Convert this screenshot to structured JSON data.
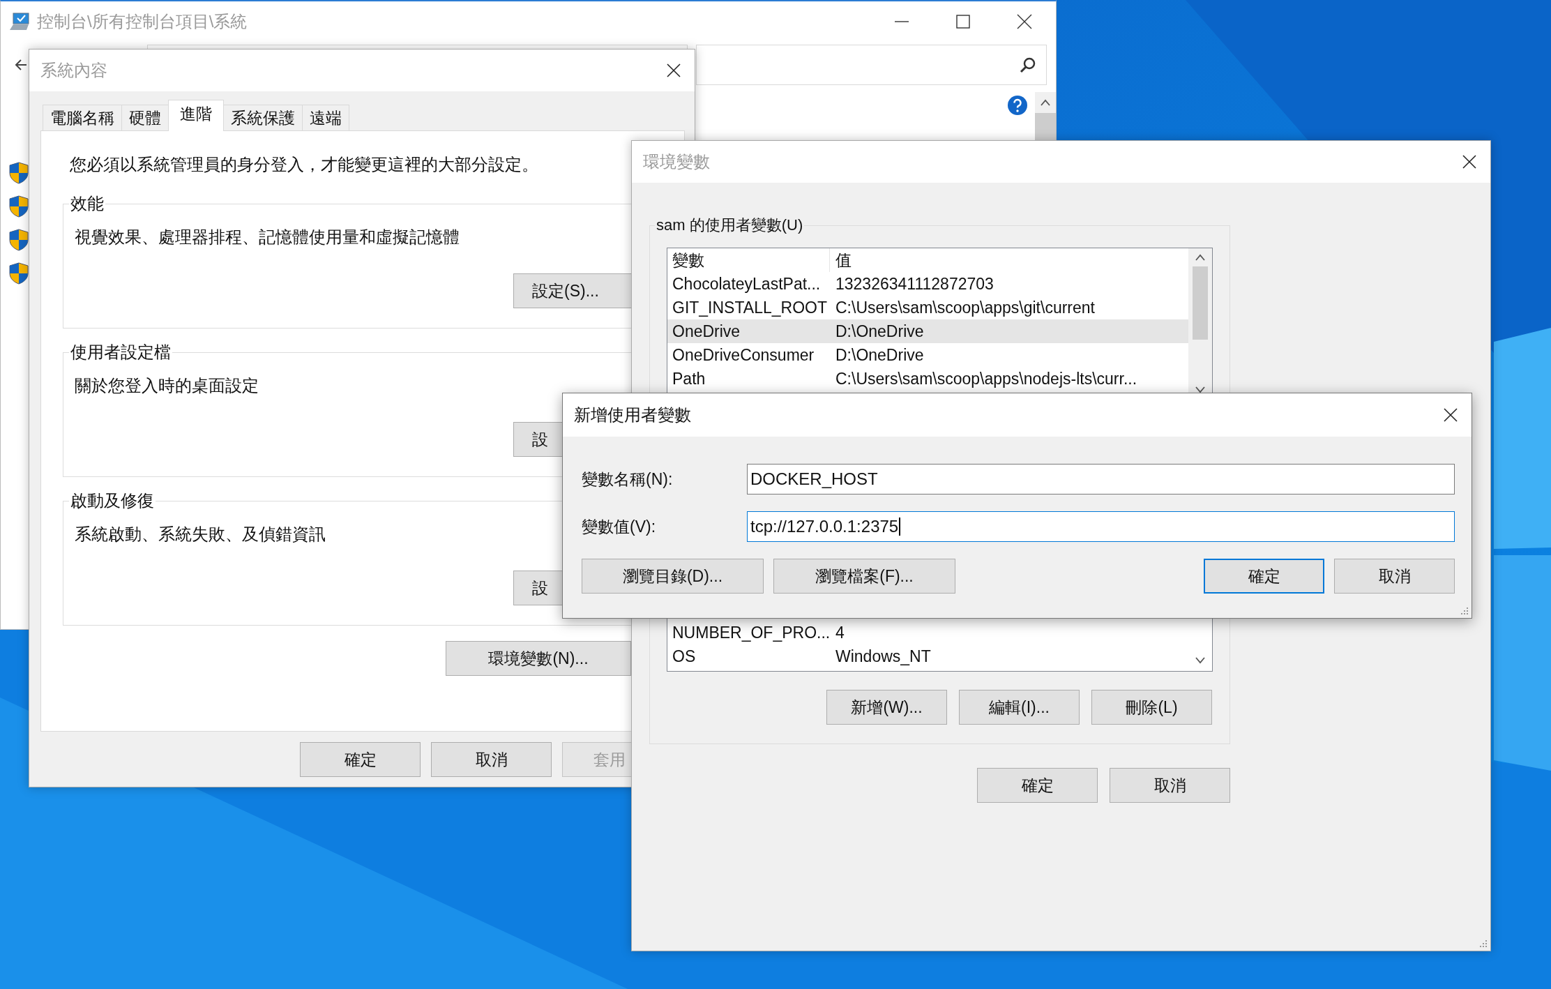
{
  "control_panel": {
    "title": "控制台\\所有控制台項目\\系統",
    "active": false
  },
  "system_properties": {
    "title": "系統內容",
    "active": false,
    "tabs": [
      {
        "label": "電腦名稱",
        "selected": false
      },
      {
        "label": "硬體",
        "selected": false
      },
      {
        "label": "進階",
        "selected": true
      },
      {
        "label": "系統保護",
        "selected": false
      },
      {
        "label": "遠端",
        "selected": false
      }
    ],
    "notice": "您必須以系統管理員的身分登入，才能變更這裡的大部分設定。",
    "groups": [
      {
        "title": "效能",
        "description": "視覺效果、處理器排程、記憶體使用量和虛擬記憶體",
        "button": "設定(S)..."
      },
      {
        "title": "使用者設定檔",
        "description": "關於您登入時的桌面設定",
        "button": "設"
      },
      {
        "title": "啟動及修復",
        "description": "系統啟動、系統失敗、及偵錯資訊",
        "button": "設"
      }
    ],
    "env_button": "環境變數(N)...",
    "buttons": [
      {
        "label": "確定",
        "disabled": false
      },
      {
        "label": "取消",
        "disabled": false
      },
      {
        "label": "套用",
        "disabled": true
      }
    ]
  },
  "environment": {
    "title": "環境變數",
    "active": false,
    "user_group": "sam 的使用者變數(U)",
    "columns": [
      "變數",
      "值"
    ],
    "user_rows": [
      {
        "name": "ChocolateyLastPat...",
        "value": "132326341112872703",
        "selected": false
      },
      {
        "name": "GIT_INSTALL_ROOT",
        "value": "C:\\Users\\sam\\scoop\\apps\\git\\current",
        "selected": false
      },
      {
        "name": "OneDrive",
        "value": "D:\\OneDrive",
        "selected": true
      },
      {
        "name": "OneDriveConsumer",
        "value": "D:\\OneDrive",
        "selected": false
      },
      {
        "name": "Path",
        "value": "C:\\Users\\sam\\scoop\\apps\\nodejs-lts\\curr...",
        "selected": false
      }
    ],
    "system_rows": [
      {
        "name": "NUMBER_OF_PRO...",
        "value": "4"
      },
      {
        "name": "OS",
        "value": "Windows_NT"
      }
    ],
    "list_buttons": [
      "新增(W)...",
      "編輯(I)...",
      "刪除(L)"
    ],
    "buttons": [
      "確定",
      "取消"
    ]
  },
  "new_variable_dialog": {
    "title": "新增使用者變數",
    "active": true,
    "fields": [
      {
        "label": "變數名稱(N):",
        "value": "DOCKER_HOST",
        "focused": false
      },
      {
        "label": "變數值(V):",
        "value": "tcp://127.0.0.1:2375",
        "focused": true
      }
    ],
    "browse_buttons": [
      "瀏覽目錄(D)...",
      "瀏覽檔案(F)..."
    ],
    "buttons": [
      {
        "label": "確定",
        "default": true
      },
      {
        "label": "取消",
        "default": false
      }
    ]
  }
}
